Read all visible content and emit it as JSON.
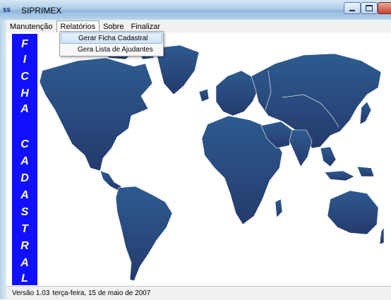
{
  "window": {
    "icon": "ss-logo-icon",
    "app_icon_text": "SS",
    "title": "SIPRIMEX",
    "min_icon": "minimize-icon",
    "max_icon": "maximize-icon",
    "close_glyph": "✕"
  },
  "menubar": {
    "items": [
      {
        "label": "Manutenção"
      },
      {
        "label": "Relatórios"
      },
      {
        "label": "Sobre"
      },
      {
        "label": "Finalizar"
      }
    ]
  },
  "dropdown": {
    "items": [
      {
        "label": "Gerar Ficha Cadastral"
      },
      {
        "label": "Gera Lista de Ajudantes"
      }
    ]
  },
  "banner": {
    "letters": [
      "F",
      "I",
      "C",
      "H",
      "A",
      "C",
      "A",
      "D",
      "A",
      "S",
      "T",
      "R",
      "A",
      "L"
    ],
    "color": "#1010ff"
  },
  "map": {
    "color": "#2b4574"
  },
  "statusbar": {
    "version": "Versão 1.03",
    "date": "terça-feira, 15 de maio de 2007"
  }
}
